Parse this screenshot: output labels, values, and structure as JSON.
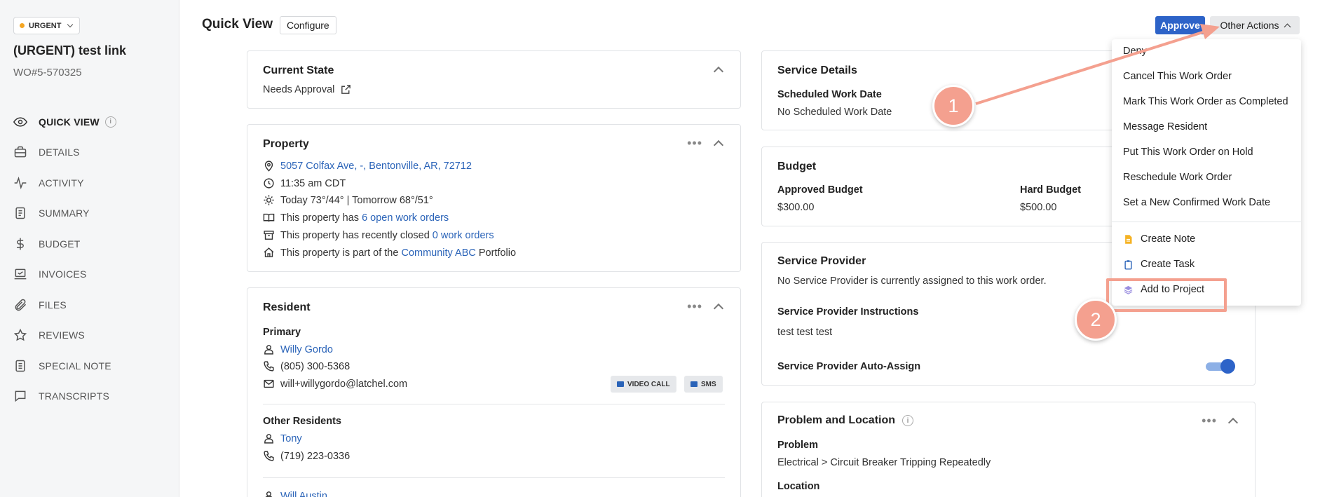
{
  "sidebar": {
    "badge": "URGENT",
    "title": "(URGENT) test link",
    "wo_number": "WO#5-570325",
    "items": [
      {
        "label": "QUICK VIEW"
      },
      {
        "label": "DETAILS"
      },
      {
        "label": "ACTIVITY"
      },
      {
        "label": "SUMMARY"
      },
      {
        "label": "BUDGET"
      },
      {
        "label": "INVOICES"
      },
      {
        "label": "FILES"
      },
      {
        "label": "REVIEWS"
      },
      {
        "label": "SPECIAL NOTE"
      },
      {
        "label": "TRANSCRIPTS"
      }
    ],
    "info_glyph": "i"
  },
  "header": {
    "title": "Quick View",
    "configure": "Configure",
    "approve": "Approve",
    "other_actions": "Other Actions"
  },
  "current_state": {
    "title": "Current State",
    "value": "Needs Approval"
  },
  "property": {
    "title": "Property",
    "address": "5057 Colfax Ave, -, Bentonville, AR, 72712",
    "time": "11:35 am CDT",
    "weather": "Today 73°/44° | Tomorrow 68°/51°",
    "open_prefix": "This property has ",
    "open_link": "6 open work orders",
    "closed_prefix": "This property has recently closed ",
    "closed_link": "0 work orders",
    "portfolio_prefix": "This property is part of the ",
    "portfolio_link": "Community ABC",
    "portfolio_suffix": " Portfolio"
  },
  "resident": {
    "title": "Resident",
    "primary_label": "Primary",
    "primary_name": "Willy Gordo",
    "primary_phone": "(805) 300-5368",
    "primary_email": "will+willygordo@latchel.com",
    "video_call": "VIDEO CALL",
    "sms": "SMS",
    "other_label": "Other Residents",
    "other_name": "Tony",
    "other_phone": "(719) 223-0336",
    "third_name": "Will Austin"
  },
  "service_details": {
    "title": "Service Details",
    "label": "Scheduled Work Date",
    "value": "No Scheduled Work Date"
  },
  "budget": {
    "title": "Budget",
    "approved_label": "Approved Budget",
    "approved_value": "$300.00",
    "hard_label": "Hard Budget",
    "hard_value": "$500.00"
  },
  "service_provider": {
    "title": "Service Provider",
    "status": "No Service Provider is currently assigned to this work order.",
    "instructions_label": "Service Provider Instructions",
    "instructions_value": "test test test",
    "auto_assign_label": "Service Provider Auto-Assign",
    "auto_assign_on": true
  },
  "problem": {
    "title": "Problem and Location",
    "problem_label": "Problem",
    "problem_value": "Electrical > Circuit Breaker Tripping Repeatedly",
    "location_label": "Location"
  },
  "menu": {
    "items": [
      "Deny",
      "Cancel This Work Order",
      "Mark This Work Order as Completed",
      "Message Resident",
      "Put This Work Order on Hold",
      "Reschedule Work Order",
      "Set a New Confirmed Work Date"
    ],
    "create_note": "Create Note",
    "create_task": "Create Task",
    "add_to_project": "Add to Project"
  },
  "annotations": {
    "step1": "1",
    "step2": "2",
    "color": "#f4a08f"
  }
}
